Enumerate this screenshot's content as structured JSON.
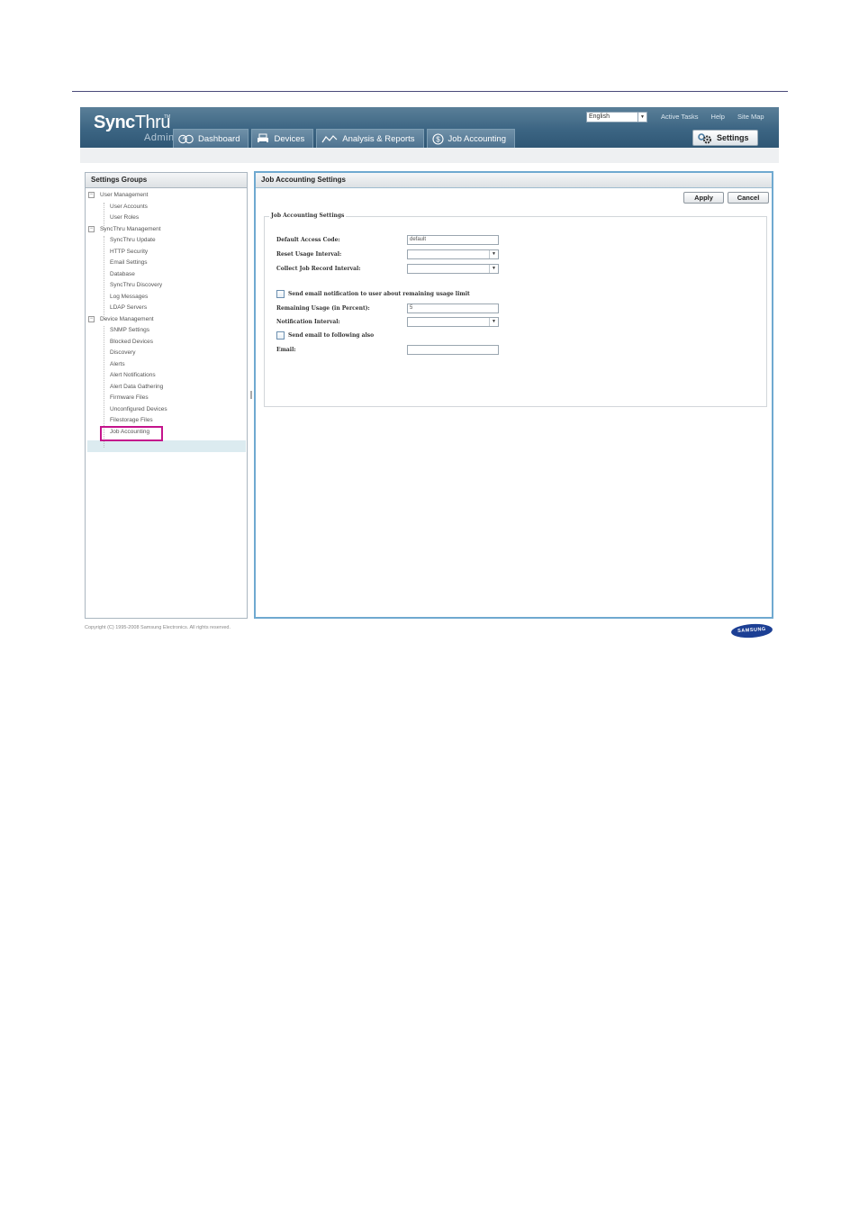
{
  "header": {
    "logo": {
      "sync": "Sync",
      "thru": "Thru",
      "tm": "TM",
      "admin": "Admin"
    },
    "tabs": [
      {
        "label": "Dashboard",
        "icon": "dashboard-icon"
      },
      {
        "label": "Devices",
        "icon": "printer-icon"
      },
      {
        "label": "Analysis & Reports",
        "icon": "chart-icon"
      },
      {
        "label": "Job Accounting",
        "icon": "dollar-icon"
      }
    ],
    "language": "English",
    "links": [
      "Active Tasks",
      "Help",
      "Site Map"
    ],
    "settings_label": "Settings"
  },
  "left": {
    "title": "Settings Groups",
    "groups": [
      {
        "label": "User Management",
        "children": [
          "User Accounts",
          "User Roles"
        ]
      },
      {
        "label": "SyncThru Management",
        "children": [
          "SyncThru Update",
          "HTTP Security",
          "Email Settings",
          "Database",
          "SyncThru Discovery",
          "Log Messages",
          "LDAP Servers"
        ]
      },
      {
        "label": "Device Management",
        "children": [
          "SNMP Settings",
          "Blocked Devices",
          "Discovery",
          "Alerts",
          "Alert Notifications",
          "Alert Data Gathering",
          "Firmware Files",
          "Unconfigured Devices",
          "Filestorage Files",
          "Job Accounting"
        ]
      }
    ],
    "selected": "Job Accounting"
  },
  "right": {
    "title": "Job Accounting Settings",
    "apply_label": "Apply",
    "cancel_label": "Cancel",
    "fieldset_legend": "Job Accounting Settings",
    "default_access_code_label": "Default Access Code:",
    "default_access_code_value": "default",
    "reset_usage_interval_label": "Reset Usage Interval:",
    "collect_job_record_interval_label": "Collect Job Record Interval:",
    "send_email_notification_label": "Send email notification to user about remaining usage limit",
    "remaining_usage_label": "Remaining Usage (in Percent):",
    "remaining_usage_value": "5",
    "notification_interval_label": "Notification Interval:",
    "send_email_following_label": "Send email to following also",
    "email_label": "Email:",
    "email_value": ""
  },
  "footer": {
    "copyright": "Copyright (C) 1995-2008 Samsung Electronics. All rights reserved.",
    "brand": "SAMSUNG"
  },
  "colors": {
    "header": "#3c6583",
    "accent": "#6fa9d0",
    "highlight": "#c4148c",
    "selected_row": "#dcebf0"
  }
}
